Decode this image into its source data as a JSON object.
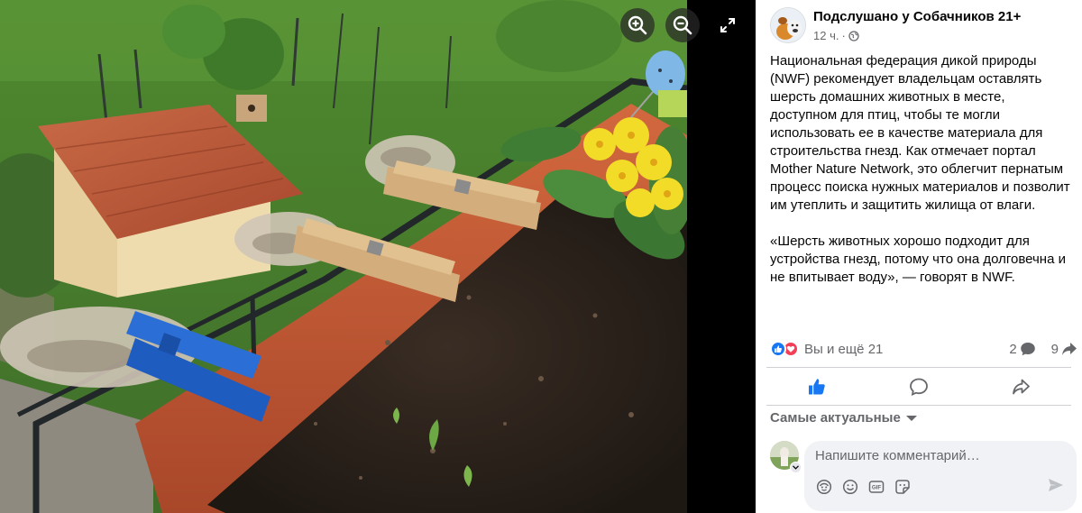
{
  "post": {
    "page_name": "Подслушано у Собачников 21+",
    "time": "12 ч.",
    "separator": "·",
    "paragraphs": [
      "Национальная федерация дикой природы (NWF) рекомендует владельцам оставлять шерсть домашних животных в месте, доступном для птиц, чтобы те могли использовать ее в качестве материала для строительства гнезд. Как отмечает портал Mother Nature Network, это облегчит пернатым процесс поиска нужных материалов и позволит им утеплить и защитить жилища от влаги.",
      "«Шерсть животных хорошо подходит для устройства гнезд, потому что она долговечна и не впитывает воду», — говорят в NWF."
    ]
  },
  "reactions": {
    "summary": "Вы и ещё 21",
    "comments_count": "2",
    "shares_count": "9"
  },
  "comments": {
    "sort_label": "Самые актуальные",
    "placeholder": "Напишите комментарий…"
  },
  "colors": {
    "accent": "#1877f2",
    "love": "#f33e58",
    "panel_bg": "#ffffff",
    "secondary_text": "#65676b"
  },
  "icons": {
    "viewer": [
      "zoom-in-icon",
      "zoom-out-icon",
      "fullscreen-icon"
    ],
    "actions": [
      "like-icon",
      "comment-icon",
      "share-icon"
    ],
    "composer": [
      "avatar-sticker-icon",
      "emoji-icon",
      "gif-icon",
      "sticker-icon",
      "send-icon"
    ]
  }
}
